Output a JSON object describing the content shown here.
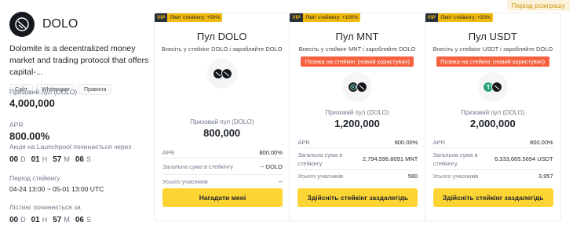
{
  "badge": "Період розіграшу",
  "token": {
    "name": "DOLO",
    "description": "Dolomite is a decentralized money market and trading protocol that offers capital-...",
    "links": [
      "Сайт",
      "Whitepaper",
      "Правила"
    ]
  },
  "stats": {
    "prize_label": "Призовий пул (DOLO)",
    "prize_value": "4,000,000",
    "apr_label": "APR",
    "apr_value": "800.00%",
    "launch_label": "Акція на Launchpool починається через",
    "countdown1": {
      "d": "00",
      "h": "01",
      "m": "57",
      "s": "06"
    },
    "units": {
      "d": "D",
      "h": "H",
      "m": "M",
      "s": "S"
    },
    "period_label": "Період стейкінгу",
    "period_value": "04-24 13:00 ~ 05-01 13:00 UTC",
    "listing_label": "Лістинг починається за",
    "countdown2": {
      "d": "00",
      "h": "01",
      "m": "57",
      "s": "06"
    }
  },
  "pools": [
    {
      "vip": "VIP",
      "limit": "Ліміт стейкінгу: +50%",
      "title": "Пул DOLO",
      "subtitle": "Внесіть у стейкінг DOLO і заробляйте DOLO",
      "newuser": "",
      "prize_label": "Призовий пул (DOLO)",
      "prize_value": "800,000",
      "apr_label": "APR",
      "apr_value": "800.00%",
      "total_label": "Загальна сума в стейкінгу",
      "total_value": "-- DOLO",
      "users_label": "Усього учасників",
      "users_value": "--",
      "button": "Нагадати мені"
    },
    {
      "vip": "VIP",
      "limit": "Ліміт стейкінгу: +100%",
      "title": "Пул MNT",
      "subtitle": "Внесіть у стейкінг MNT і заробляйте DOLO",
      "newuser": "Позика на стейкінг (новий користувач)",
      "prize_label": "Призовий пул (DOLO)",
      "prize_value": "1,200,000",
      "apr_label": "APR",
      "apr_value": "800.00%",
      "total_label": "Загальна сума в стейкінгу",
      "total_value": "2,794,596.8091 MNT",
      "users_label": "Усього учасників",
      "users_value": "560",
      "button": "Здійсніть стейкінг заздалегідь"
    },
    {
      "vip": "VIP",
      "limit": "Ліміт стейкінгу: +50%",
      "title": "Пул USDT",
      "subtitle": "Внесіть у стейкінг USDT і заробляйте DOLO",
      "newuser": "Позика на стейкінг (новий користувач)",
      "prize_label": "Призовий пул (DOLO)",
      "prize_value": "2,000,000",
      "apr_label": "APR",
      "apr_value": "800.00%",
      "total_label": "Загальна сума в стейкінгу",
      "total_value": "6,333,665.5694 USDT",
      "users_label": "Усього учасників",
      "users_value": "3,957",
      "button": "Здійсніть стейкінг заздалегідь"
    }
  ],
  "colors": {
    "accent": "#fcd535",
    "orange": "#f6613f",
    "vip_bg": "#2b3139"
  },
  "icons": [
    "dolo-logo-icon",
    "dolo-coin-icon",
    "mnt-coin-icon",
    "usdt-coin-icon"
  ]
}
